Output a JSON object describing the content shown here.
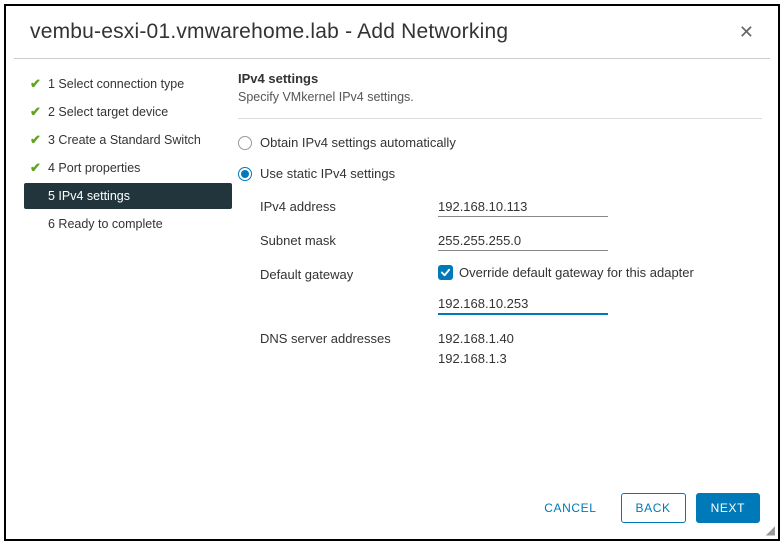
{
  "dialog": {
    "title": "vembu-esxi-01.vmwarehome.lab - Add Networking"
  },
  "steps": [
    {
      "label": "1 Select connection type",
      "state": "done"
    },
    {
      "label": "2 Select target device",
      "state": "done"
    },
    {
      "label": "3 Create a Standard Switch",
      "state": "done"
    },
    {
      "label": "4 Port properties",
      "state": "done"
    },
    {
      "label": "5 IPv4 settings",
      "state": "active"
    },
    {
      "label": "6 Ready to complete",
      "state": "future"
    }
  ],
  "panel": {
    "heading": "IPv4 settings",
    "subheading": "Specify VMkernel IPv4 settings."
  },
  "radio": {
    "auto": "Obtain IPv4 settings automatically",
    "static": "Use static IPv4 settings",
    "selected": "static"
  },
  "fields": {
    "ipv4_label": "IPv4 address",
    "ipv4_value": "192.168.10.113",
    "subnet_label": "Subnet mask",
    "subnet_value": "255.255.255.0",
    "gateway_label": "Default gateway",
    "override_label": "Override default gateway for this adapter",
    "override_checked": true,
    "gateway_value": "192.168.10.253",
    "dns_label": "DNS server addresses",
    "dns1": "192.168.1.40",
    "dns2": "192.168.1.3"
  },
  "buttons": {
    "cancel": "CANCEL",
    "back": "BACK",
    "next": "NEXT"
  }
}
